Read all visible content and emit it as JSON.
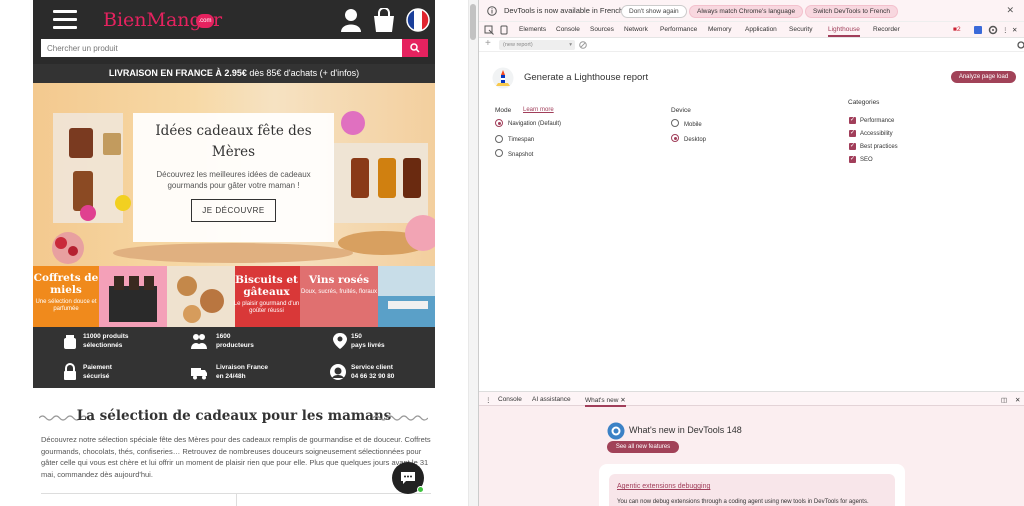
{
  "site": {
    "logo_text": "BienManger",
    "logo_badge": ".com",
    "search_placeholder": "Chercher un produit",
    "shipping_bold": "LIVRAISON EN FRANCE À 2.95€",
    "shipping_rest": " dès 85€ d'achats (+ d'infos)",
    "hero": {
      "title": "Idées cadeaux fête des Mères",
      "text": "Découvrez les meilleures idées de cadeaux gourmands pour gâter votre maman !",
      "button": "JE DÉCOUVRE"
    },
    "tiles": [
      {
        "title": "Coffrets de miels",
        "sub": "Une sélection douce et parfumée",
        "color": "#f08a1c"
      },
      {
        "title": "Biscuits et gâteaux",
        "sub": "Le plaisir gourmand d'un goûter réussi",
        "color": "#d93838"
      },
      {
        "title": "Vins rosés",
        "sub": "Doux, sucrés, fruités, floraux",
        "color": "#e07070"
      }
    ],
    "perks": [
      {
        "line1": "11000 produits",
        "line2": "sélectionnés"
      },
      {
        "line1": "1600",
        "line2": "producteurs"
      },
      {
        "line1": "150",
        "line2": "pays livrés"
      },
      {
        "line1": "Paiement",
        "line2": "sécurisé"
      },
      {
        "line1": "Livraison France",
        "line2": "en 24/48h"
      },
      {
        "line1": "Service client",
        "line2": "04 66 32 90 80"
      }
    ],
    "selection_title": "La sélection de cadeaux pour les mamans",
    "selection_text": "Découvrez notre sélection spéciale fête des Mères pour des cadeaux remplis de gourmandise et de douceur. Coffrets gourmands, chocolats, thés, confiseries… Retrouvez de nombreuses douceurs soigneusement sélectionnées pour gâter celle qui vous est chère et lui offrir un moment de plaisir rien que pour elle. Plus que quelques jours avant le 31 mai, commandez dès aujourd'hui."
  },
  "devtools": {
    "infobar": {
      "message": "DevTools is now available in French",
      "btn_dont_show": "Don't show again",
      "btn_match": "Always match Chrome's language",
      "btn_switch": "Switch DevTools to French"
    },
    "tabs": [
      "Elements",
      "Console",
      "Sources",
      "Network",
      "Performance",
      "Memory",
      "Application",
      "Security",
      "Lighthouse",
      "Recorder"
    ],
    "issues_count": "2",
    "toolbar_select": "(new report)",
    "lighthouse": {
      "title": "Generate a Lighthouse report",
      "analyze": "Analyze page load",
      "mode_label": "Mode",
      "learn_more": "Learn more",
      "modes": [
        "Navigation (Default)",
        "Timespan",
        "Snapshot"
      ],
      "device_label": "Device",
      "devices": [
        "Mobile",
        "Desktop"
      ],
      "categories_label": "Categories",
      "categories": [
        "Performance",
        "Accessibility",
        "Best practices",
        "SEO"
      ]
    },
    "drawer": {
      "tabs": [
        "Console",
        "AI assistance",
        "What's new"
      ],
      "whats_new_title": "What's new in DevTools 148",
      "see_all": "See all new features",
      "card_link": "Agentic extensions debugging",
      "card_desc": "You can now debug extensions through a coding agent using new tools in DevTools for agents."
    }
  },
  "colors": {
    "brand": "#e5225f",
    "devtools_accent": "#a13e5a"
  }
}
